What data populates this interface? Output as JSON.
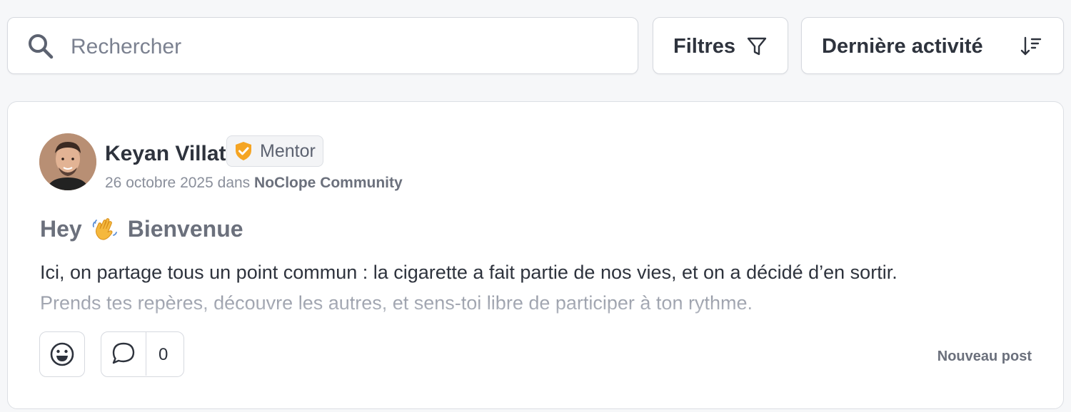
{
  "search": {
    "placeholder": "Rechercher",
    "icon": "search-icon"
  },
  "toolbar": {
    "filters_label": "Filtres",
    "filters_icon": "filter-funnel-icon",
    "sort_label": "Dernière activité",
    "sort_icon": "sort-descending-icon"
  },
  "post": {
    "author": {
      "name": "Keyan Villat",
      "badge": "Mentor",
      "badge_color": "#f5a524"
    },
    "date": "26 octobre 2025",
    "in_word": "dans",
    "community": "NoClope Community",
    "title_before": "Hey",
    "title_emoji": "👋",
    "title_after": "Bienvenue",
    "excerpt_line1": "  Ici, on partage tous un point commun : la cigarette a fait partie de nos vies, et on a décidé d’en sortir.",
    "excerpt_line2": "Prends tes repères, découvre les autres, et sens-toi libre de participer à ton rythme.",
    "comment_count": "0",
    "new_post_label": "Nouveau post"
  }
}
